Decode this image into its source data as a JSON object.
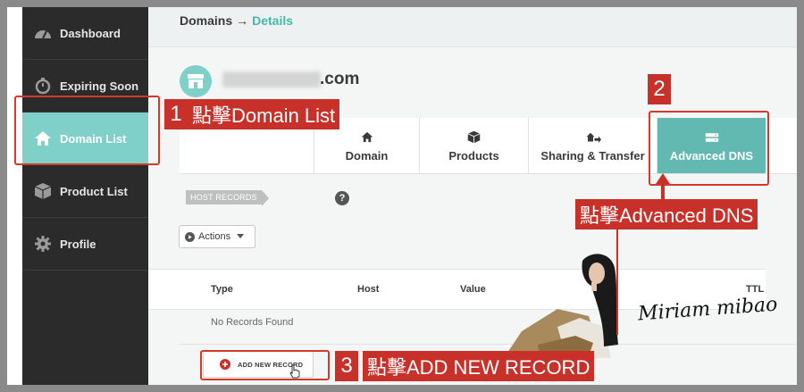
{
  "sidebar": {
    "items": [
      {
        "label": "Dashboard",
        "icon": "gauge-icon"
      },
      {
        "label": "Expiring Soon",
        "icon": "stopwatch-icon"
      },
      {
        "label": "Domain List",
        "icon": "home-icon",
        "active": true
      },
      {
        "label": "Product List",
        "icon": "box-icon"
      },
      {
        "label": "Profile",
        "icon": "gear-icon"
      }
    ]
  },
  "breadcrumb": {
    "root": "Domains",
    "separator": "→",
    "current": "Details"
  },
  "domain": {
    "tld": ".com"
  },
  "tabs": [
    {
      "label": "Domain",
      "icon": "home-icon"
    },
    {
      "label": "Products",
      "icon": "box-icon"
    },
    {
      "label": "Sharing & Transfer",
      "icon": "transfer-icon"
    },
    {
      "label": "Advanced DNS",
      "icon": "server-icon",
      "active": true
    }
  ],
  "host_records": {
    "label": "HOST RECORDS",
    "help": "?"
  },
  "actions": {
    "label": "Actions"
  },
  "table": {
    "columns": [
      "Type",
      "Host",
      "Value",
      "TTL"
    ],
    "empty_message": "No Records Found"
  },
  "add_record": {
    "label": "ADD NEW RECORD"
  },
  "annotations": {
    "step1_num": "1",
    "step1_text": "點擊Domain List",
    "step2_num": "2",
    "step2_text": "點擊Advanced DNS",
    "step3_num": "3",
    "step3_text": "點擊ADD NEW RECORD"
  },
  "signature": {
    "text": "Miriam mibao"
  },
  "colors": {
    "accent": "#7fd0c9",
    "tab_active": "#62b9b1",
    "annotation": "#c8312a",
    "sidebar": "#2b2b2b"
  }
}
